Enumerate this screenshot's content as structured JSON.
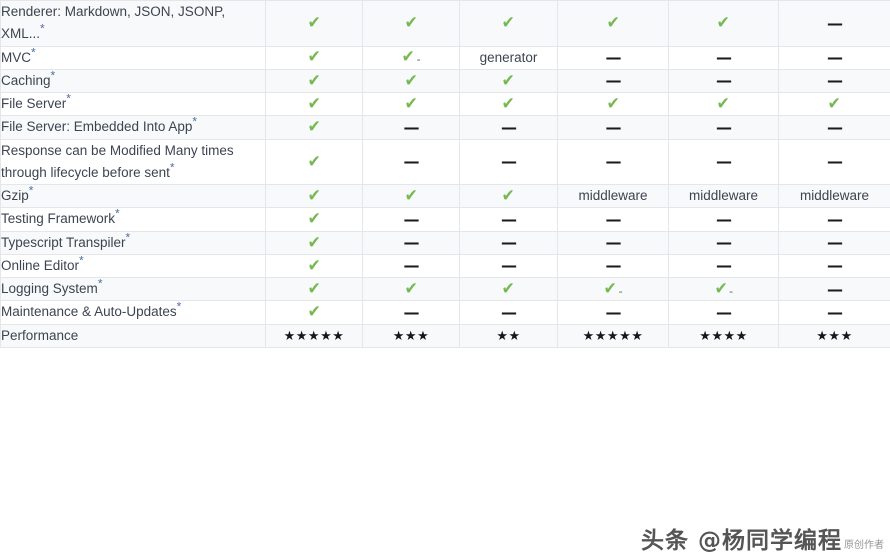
{
  "table": {
    "rows": [
      {
        "label": "Renderer: Markdown, JSON, JSONP, XML...",
        "note": "*",
        "values": [
          "check",
          "check",
          "check",
          "check",
          "check",
          "dash"
        ],
        "texts": [
          "",
          "",
          "",
          "",
          "",
          ""
        ]
      },
      {
        "label": "MVC",
        "note": "*",
        "values": [
          "check",
          "check-minor",
          "text",
          "dash",
          "dash",
          "dash"
        ],
        "texts": [
          "",
          "",
          "generator",
          "",
          "",
          ""
        ]
      },
      {
        "label": "Caching",
        "note": "*",
        "values": [
          "check",
          "check",
          "check",
          "dash",
          "dash",
          "dash"
        ],
        "texts": [
          "",
          "",
          "",
          "",
          "",
          ""
        ]
      },
      {
        "label": "File Server",
        "note": "*",
        "values": [
          "check",
          "check",
          "check",
          "check",
          "check",
          "check"
        ],
        "texts": [
          "",
          "",
          "",
          "",
          "",
          ""
        ]
      },
      {
        "label": "File Server: Embedded Into App",
        "note": "*",
        "values": [
          "check",
          "dash",
          "dash",
          "dash",
          "dash",
          "dash"
        ],
        "texts": [
          "",
          "",
          "",
          "",
          "",
          ""
        ]
      },
      {
        "label": "Response can be Modified Many times through lifecycle before sent",
        "note": "*",
        "values": [
          "check",
          "dash",
          "dash",
          "dash",
          "dash",
          "dash"
        ],
        "texts": [
          "",
          "",
          "",
          "",
          "",
          ""
        ]
      },
      {
        "label": "Gzip",
        "note": "*",
        "values": [
          "check",
          "check",
          "check",
          "text",
          "text",
          "text"
        ],
        "texts": [
          "",
          "",
          "",
          "middleware",
          "middleware",
          "middleware"
        ]
      },
      {
        "label": "Testing Framework",
        "note": "*",
        "values": [
          "check",
          "dash",
          "dash",
          "dash",
          "dash",
          "dash"
        ],
        "texts": [
          "",
          "",
          "",
          "",
          "",
          ""
        ]
      },
      {
        "label": "Typescript Transpiler",
        "note": "*",
        "values": [
          "check",
          "dash",
          "dash",
          "dash",
          "dash",
          "dash"
        ],
        "texts": [
          "",
          "",
          "",
          "",
          "",
          ""
        ]
      },
      {
        "label": "Online Editor",
        "note": "*",
        "values": [
          "check",
          "dash",
          "dash",
          "dash",
          "dash",
          "dash"
        ],
        "texts": [
          "",
          "",
          "",
          "",
          "",
          ""
        ]
      },
      {
        "label": "Logging System",
        "note": "*",
        "values": [
          "check",
          "check",
          "check",
          "check-minor",
          "check-minor",
          "dash"
        ],
        "texts": [
          "",
          "",
          "",
          "",
          "",
          ""
        ]
      },
      {
        "label": "Maintenance & Auto-Updates",
        "note": "*",
        "values": [
          "check",
          "dash",
          "dash",
          "dash",
          "dash",
          "dash"
        ],
        "texts": [
          "",
          "",
          "",
          "",
          "",
          ""
        ]
      },
      {
        "label": "Performance",
        "note": "",
        "values": [
          "stars",
          "stars",
          "stars",
          "stars",
          "stars",
          "stars"
        ],
        "texts": [
          "★★★★★",
          "★★★",
          "★★",
          "★★★★★",
          "★★★★",
          "★★★"
        ]
      }
    ],
    "glyphs": {
      "check": "✔",
      "dash": "—",
      "minor": "-"
    }
  },
  "watermark": {
    "text": "头条 @杨同学编程",
    "sub": "原创作者"
  },
  "colors": {
    "check": "#76b852",
    "dash": "#1b1b1b",
    "note": "#4d6fa8",
    "border": "#e3e7eb",
    "stripe": "#f7f9fa",
    "text": "#3d4451"
  }
}
